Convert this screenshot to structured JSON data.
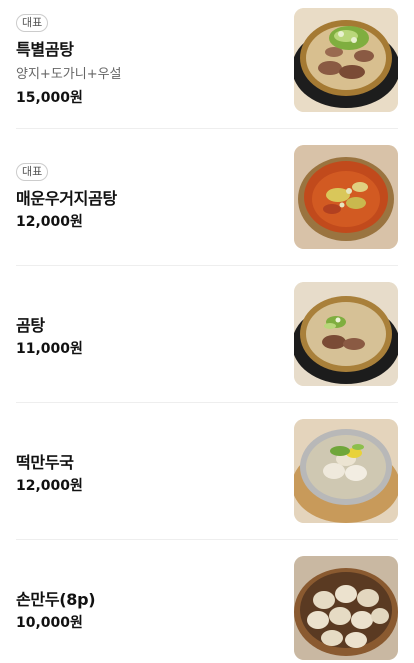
{
  "menu": {
    "items": [
      {
        "badge": "대표",
        "name": "특별곰탕",
        "description": "양지+도가니+우설",
        "price": "15,000원",
        "image_icon": "beef-bone-soup-with-scallions-icon"
      },
      {
        "badge": "대표",
        "name": "매운우거지곰탕",
        "price": "12,000원",
        "image_icon": "spicy-cabbage-beef-soup-icon"
      },
      {
        "name": "곰탕",
        "price": "11,000원",
        "image_icon": "beef-bone-soup-icon"
      },
      {
        "name": "떡만두국",
        "price": "12,000원",
        "image_icon": "rice-cake-dumpling-soup-icon"
      },
      {
        "name": "손만두(8p)",
        "price": "10,000원",
        "image_icon": "dumpling-plate-icon"
      }
    ]
  },
  "colors": {
    "text": "#111111",
    "secondary_text": "#666666",
    "badge_border": "#cccccc",
    "divider": "#eeeeee"
  }
}
